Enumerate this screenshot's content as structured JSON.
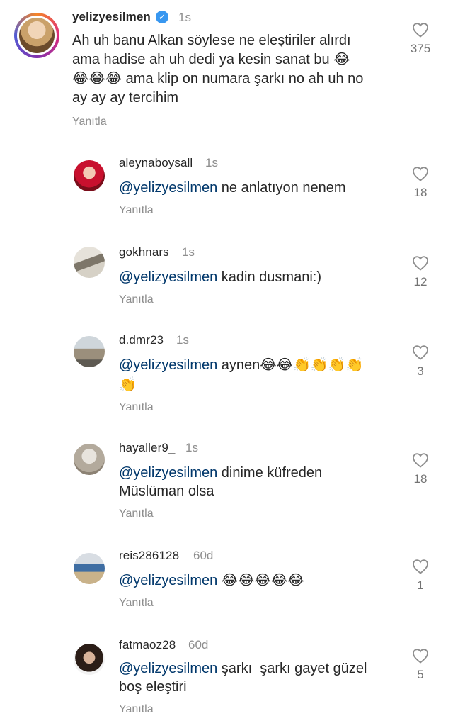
{
  "main_comment": {
    "username": "yelizyesilmen",
    "time": "1s",
    "lines": [
      "Ah uh banu Alkan söylese ne eleştiriler alırdı",
      "ama hadise ah uh dedi ya kesin sanat bu 😂",
      "😂😂😂 ama klip on numara şarkı no ah uh no",
      "ay ay ay tercihim"
    ],
    "reply_label": "Yanıtla",
    "likes": "375"
  },
  "replies": [
    {
      "username": "aleynaboysall",
      "time": "1s",
      "mention": "@yelizyesilmen",
      "lines": [
        " ne anlatıyon nenem"
      ],
      "reply_label": "Yanıtla",
      "likes": "18"
    },
    {
      "username": "gokhnars",
      "time": "1s",
      "mention": "@yelizyesilmen",
      "lines": [
        " kadin dusmani:)"
      ],
      "reply_label": "Yanıtla",
      "likes": "12"
    },
    {
      "username": "d.dmr23",
      "time": "1s",
      "mention": "@yelizyesilmen",
      "lines": [
        " aynen😂😂👏👏👏👏",
        "👏"
      ],
      "reply_label": "Yanıtla",
      "likes": "3"
    },
    {
      "username": "hayaller9_",
      "time": "1s",
      "mention": "@yelizyesilmen",
      "lines": [
        " dinime küfreden",
        "Müslüman olsa"
      ],
      "reply_label": "Yanıtla",
      "likes": "18"
    },
    {
      "username": "reis286128",
      "time": "60d",
      "mention": "@yelizyesilmen",
      "lines": [
        " 😂😂😂😂😂"
      ],
      "reply_label": "Yanıtla",
      "likes": "1"
    },
    {
      "username": "fatmaoz28",
      "time": "60d",
      "mention": "@yelizyesilmen",
      "lines": [
        " şarkı  şarkı gayet güzel",
        "boş eleştiri"
      ],
      "reply_label": "Yanıtla",
      "likes": "5"
    }
  ],
  "colors": {
    "mention": "#00376b",
    "muted": "#8e8e8e",
    "verified": "#3897f0"
  },
  "icons": {
    "like": "heart-outline-icon",
    "verified": "verified-badge-icon"
  }
}
